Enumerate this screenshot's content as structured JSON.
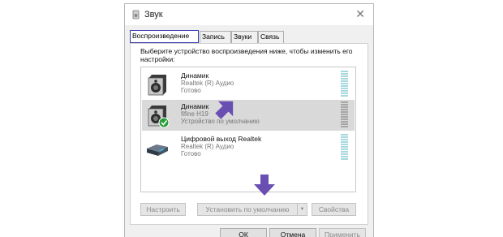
{
  "window": {
    "title": "Звук",
    "close_glyph": "✕"
  },
  "tabs": [
    {
      "label": "Воспроизведение",
      "active": true
    },
    {
      "label": "Запись",
      "active": false
    },
    {
      "label": "Звуки",
      "active": false
    },
    {
      "label": "Связь",
      "active": false
    }
  ],
  "description": "Выберите устройство воспроизведения ниже, чтобы изменить его настройки:",
  "devices": [
    {
      "name": "Динамик",
      "driver": "Realtek (R) Аудио",
      "status": "Готово",
      "icon": "speaker-icon",
      "selected": false
    },
    {
      "name": "Динамик",
      "driver": "fifine H19",
      "status": "Устройство по умолчанию",
      "icon": "speaker-default-icon",
      "selected": true
    },
    {
      "name": "Цифровой выход Realtek",
      "driver": "Realtek (R) Аудио",
      "status": "Готово",
      "icon": "digital-output-icon",
      "selected": false
    }
  ],
  "buttons": {
    "configure": "Настроить",
    "set_default": "Установить по умолчанию",
    "properties": "Свойства",
    "ok": "ОК",
    "cancel": "Отмена",
    "apply": "Применить"
  },
  "colors": {
    "accent_arrow": "#6a4fb3",
    "selection": "#d9d9d9",
    "active_tab_border": "#3b3bb0",
    "default_check": "#2a9d3a"
  }
}
